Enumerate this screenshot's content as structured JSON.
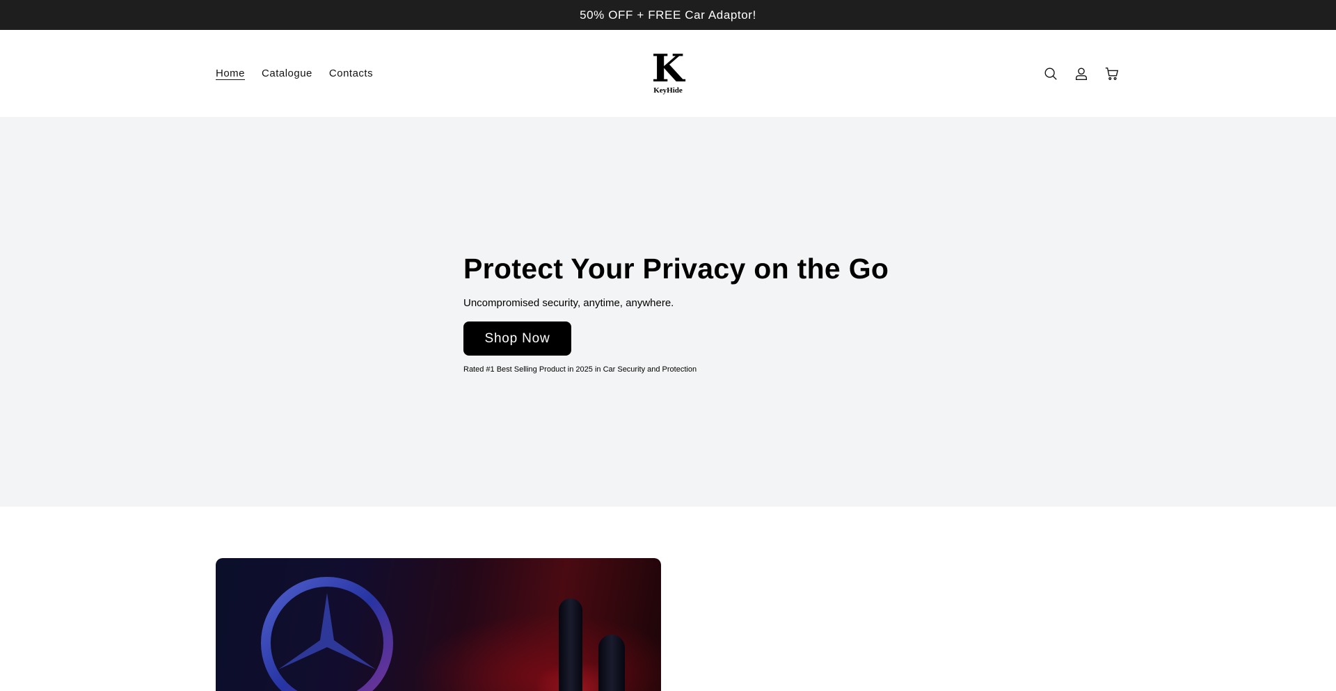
{
  "announcement": {
    "text": "50% OFF + FREE Car Adaptor!"
  },
  "header": {
    "nav": [
      {
        "label": "Home",
        "active": true
      },
      {
        "label": "Catalogue",
        "active": false
      },
      {
        "label": "Contacts",
        "active": false
      }
    ],
    "logo": {
      "mark": "K",
      "wordmark": "KeyHide"
    },
    "icons": [
      "search-icon",
      "account-icon",
      "cart-icon"
    ]
  },
  "hero": {
    "title": "Protect Your Privacy on the Go",
    "subtitle": "Uncompromised security, anytime, anywhere.",
    "button_label": "Shop Now",
    "note": "Rated #1 Best Selling Product in 2025 in Car Security and Protection",
    "background_color": "#f3f4f5"
  },
  "colors": {
    "announcement_bg": "#1e1e1f",
    "button_bg": "#000000",
    "text": "#121212"
  }
}
